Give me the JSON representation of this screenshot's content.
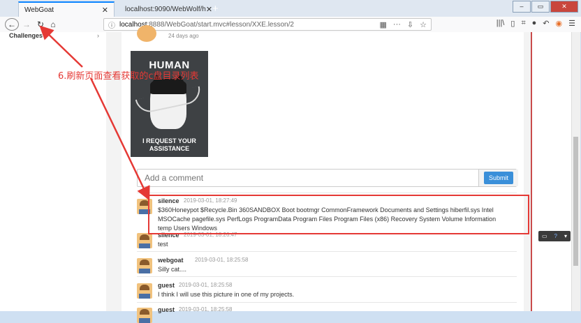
{
  "browser": {
    "tabs": [
      {
        "title": "WebGoat",
        "active": true
      },
      {
        "title": "localhost:9090/WebWolf/h",
        "active": false
      }
    ],
    "new_tab": "+",
    "url_host": "localhost",
    "url_rest": ":8888/WebGoat/start.mvc#lesson/XXE.lesson/2"
  },
  "sidebar": {
    "item": "Challenges",
    "chevron": "›"
  },
  "post": {
    "ago": "24 days ago"
  },
  "meme": {
    "top_text": "HUMAN",
    "bottom_line1": "I REQUEST YOUR",
    "bottom_line2": "ASSISTANCE"
  },
  "comment_form": {
    "placeholder": "Add a comment",
    "submit_label": "Submit"
  },
  "comments": [
    {
      "author": "silence",
      "date": "2019-03-01, 18:27:49",
      "text": "$360Honeypot $Recycle.Bin 360SANDBOX Boot bootmgr CommonFramework Documents and Settings hiberfil.sys Intel MSOCache pagefile.sys PerfLogs ProgramData Program Files Program Files (x86) Recovery System Volume Information temp Users Windows"
    },
    {
      "author": "silence",
      "date": "2019-03-01, 18:26:47",
      "text": "test"
    },
    {
      "author": "webgoat",
      "date": "2019-03-01, 18:25:58",
      "text": "Silly cat...."
    },
    {
      "author": "guest",
      "date": "2019-03-01, 18:25:58",
      "text": "I think I will use this picture in one of my projects."
    },
    {
      "author": "guest",
      "date": "2019-03-01, 18:25:58",
      "text": ""
    }
  ],
  "annotation": {
    "label": "6.刷新页面查看获取的c盘目录列表",
    "color": "#e53935"
  },
  "colors": {
    "accent": "#3a8fd9",
    "highlight": "#e53935"
  }
}
